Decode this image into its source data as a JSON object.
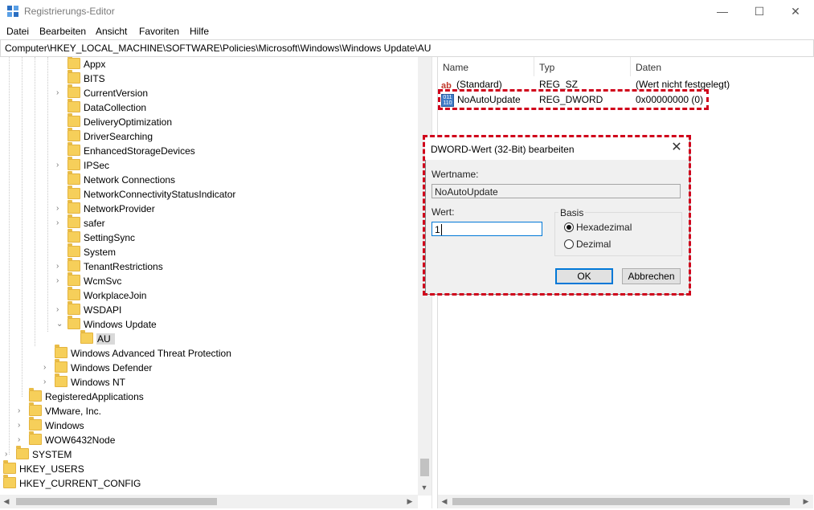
{
  "window": {
    "title": "Registrierungs-Editor",
    "minimize": "—",
    "maximize": "☐",
    "close": "✕"
  },
  "menu": [
    "Datei",
    "Bearbeiten",
    "Ansicht",
    "Favoriten",
    "Hilfe"
  ],
  "address": "Computer\\HKEY_LOCAL_MACHINE\\SOFTWARE\\Policies\\Microsoft\\Windows\\Windows Update\\AU",
  "tree": {
    "items": [
      {
        "label": "Appx",
        "chev": ""
      },
      {
        "label": "BITS",
        "chev": ""
      },
      {
        "label": "CurrentVersion",
        "chev": "›"
      },
      {
        "label": "DataCollection",
        "chev": ""
      },
      {
        "label": "DeliveryOptimization",
        "chev": ""
      },
      {
        "label": "DriverSearching",
        "chev": ""
      },
      {
        "label": "EnhancedStorageDevices",
        "chev": ""
      },
      {
        "label": "IPSec",
        "chev": "›"
      },
      {
        "label": "Network Connections",
        "chev": ""
      },
      {
        "label": "NetworkConnectivityStatusIndicator",
        "chev": ""
      },
      {
        "label": "NetworkProvider",
        "chev": "›"
      },
      {
        "label": "safer",
        "chev": "›"
      },
      {
        "label": "SettingSync",
        "chev": ""
      },
      {
        "label": "System",
        "chev": ""
      },
      {
        "label": "TenantRestrictions",
        "chev": "›"
      },
      {
        "label": "WcmSvc",
        "chev": "›"
      },
      {
        "label": "WorkplaceJoin",
        "chev": ""
      },
      {
        "label": "WSDAPI",
        "chev": "›"
      },
      {
        "label": "Windows Update",
        "chev": "⌄"
      },
      {
        "label": "AU",
        "chev": ""
      },
      {
        "label": "Windows Advanced Threat Protection",
        "chev": ""
      },
      {
        "label": "Windows Defender",
        "chev": "›"
      },
      {
        "label": "Windows NT",
        "chev": "›"
      },
      {
        "label": "RegisteredApplications",
        "chev": ""
      },
      {
        "label": "VMware, Inc.",
        "chev": "›"
      },
      {
        "label": "Windows",
        "chev": "›"
      },
      {
        "label": "WOW6432Node",
        "chev": "›"
      },
      {
        "label": "SYSTEM",
        "chev": "›"
      },
      {
        "label": "HKEY_USERS",
        "chev": "›"
      },
      {
        "label": "HKEY_CURRENT_CONFIG",
        "chev": "›"
      }
    ]
  },
  "list": {
    "columns": [
      "Name",
      "Typ",
      "Daten"
    ],
    "rows": [
      {
        "icon": "ab",
        "name": "(Standard)",
        "type": "REG_SZ",
        "data": "(Wert nicht festgelegt)"
      },
      {
        "icon": "011\n110",
        "name": "NoAutoUpdate",
        "type": "REG_DWORD",
        "data": "0x00000000 (0)"
      }
    ]
  },
  "dialog": {
    "title": "DWORD-Wert (32-Bit) bearbeiten",
    "close": "✕",
    "name_label": "Wertname:",
    "name_value": "NoAutoUpdate",
    "value_label": "Wert:",
    "value": "1",
    "base_label": "Basis",
    "hex_label": "Hexadezimal",
    "dec_label": "Dezimal",
    "base_selected": "Hexadezimal",
    "ok_label": "OK",
    "cancel_label": "Abbrechen"
  },
  "scrollbar": {
    "up": "▲",
    "down": "▼",
    "left": "◀",
    "right": "▶"
  },
  "colors": {
    "highlight": "#d0021b",
    "accent": "#0078d7"
  }
}
